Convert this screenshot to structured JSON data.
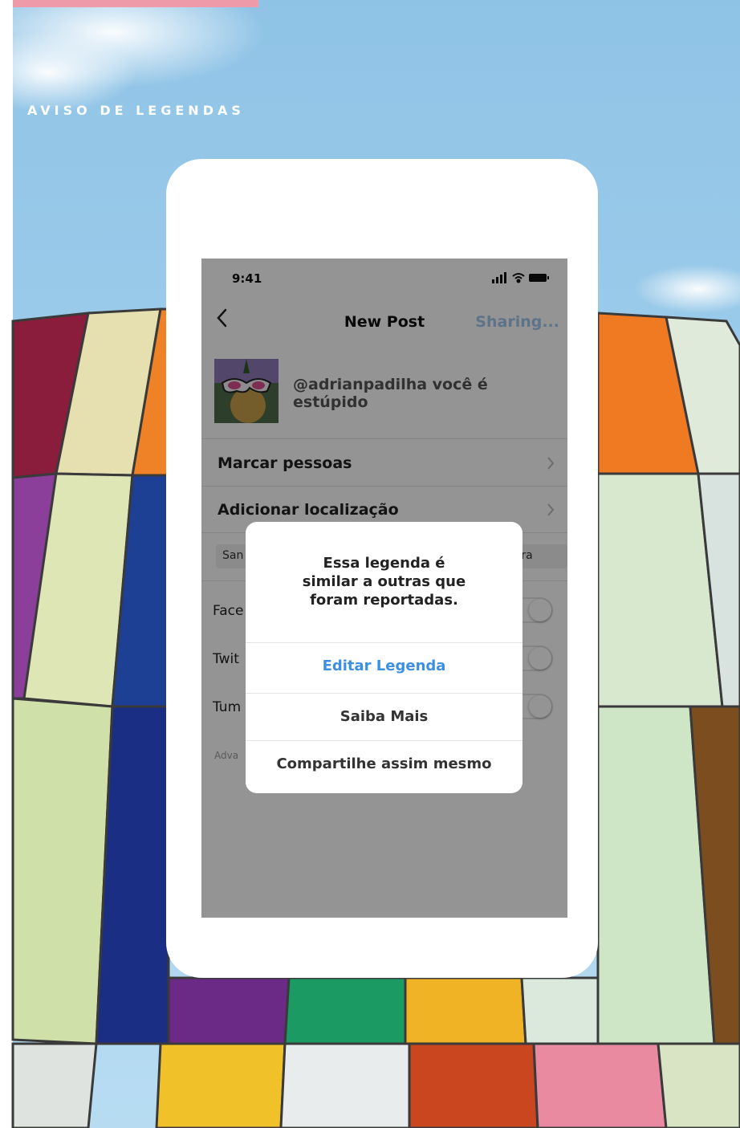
{
  "page": {
    "section_label": "AVISO DE LEGENDAS",
    "accent_color": "#ee9aa8"
  },
  "status_bar": {
    "time": "9:41",
    "icons": [
      "signal-icon",
      "wifi-icon",
      "battery-icon"
    ]
  },
  "nav": {
    "back_icon": "chevron-left-icon",
    "title": "New Post",
    "share_label": "Sharing..."
  },
  "post": {
    "caption": "@adrianpadilha você é estúpido"
  },
  "options": {
    "tag_people": "Marcar pessoas",
    "add_location": "Adicionar localização"
  },
  "location_chips": [
    "San",
    "n Fra"
  ],
  "share_targets": [
    "Face",
    "Twit",
    "Tum"
  ],
  "advanced_label": "Adva",
  "alert": {
    "message": "Essa legenda é\nsimilar a outras que\nforam reportadas.",
    "edit_caption": "Editar Legenda",
    "learn_more": "Saiba Mais",
    "share_anyway": "Compartilhe assim mesmo",
    "primary_color": "#3d8fe3"
  }
}
